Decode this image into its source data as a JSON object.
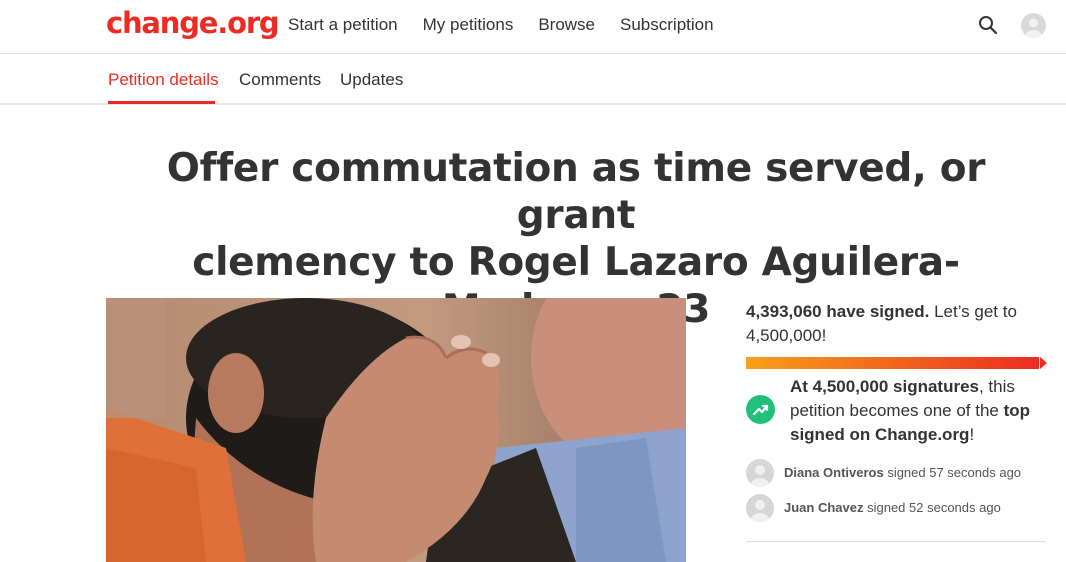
{
  "header": {
    "logo": "change.org",
    "nav": [
      "Start a petition",
      "My petitions",
      "Browse",
      "Subscription"
    ]
  },
  "tabs": [
    {
      "label": "Petition details",
      "active": true
    },
    {
      "label": "Comments",
      "active": false
    },
    {
      "label": "Updates",
      "active": false
    }
  ],
  "petition": {
    "title_line1": "Offer commutation as time served, or grant",
    "title_line2": "clemency to Rogel Lazaro Aguilera-Mederos, 23"
  },
  "signatures": {
    "count": "4,393,060 have signed.",
    "goal_text_a": " Let’s get to",
    "goal_text_b": "4,500,000!",
    "progress": 0.976
  },
  "milestone": {
    "part1": "At 4,500,000 signatures",
    "part2": ", this petition becomes one of the ",
    "part3": "top signed on Change.org",
    "part4": "!"
  },
  "recent_signers": [
    {
      "name": "Diana Ontiveros",
      "action": " signed 57 seconds ago"
    },
    {
      "name": "Juan Chavez",
      "action": " signed 52 seconds ago"
    }
  ],
  "colors": {
    "brand": "#ec2c22",
    "progress_start": "#f6a01a",
    "progress_end": "#ec2c22",
    "trend_icon": "#21c07a"
  }
}
